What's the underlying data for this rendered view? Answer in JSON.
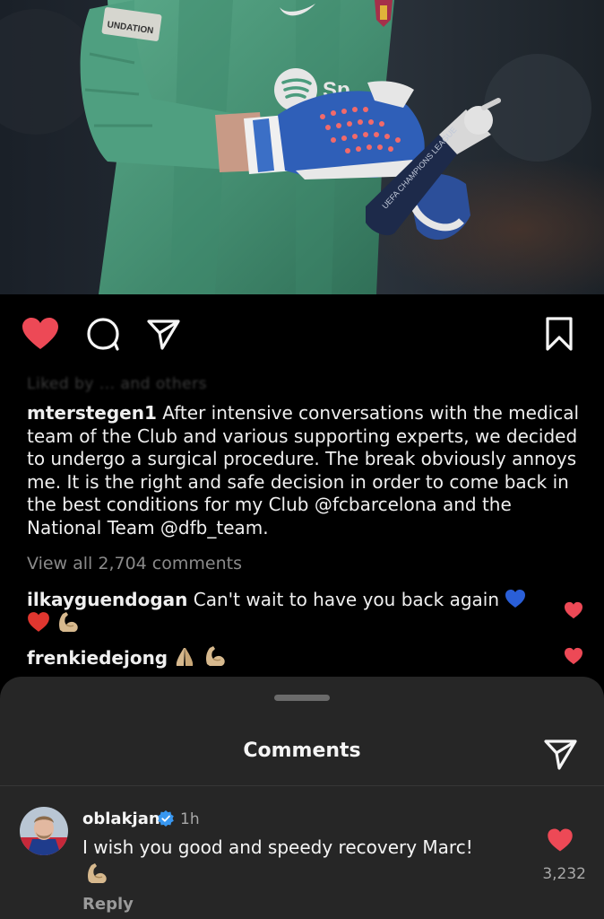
{
  "photo": {
    "collar_badge_text": "UNDATION",
    "sponsor_text": "Sp",
    "bottle_text": "UEFA CHAMPIONS LEAGUE"
  },
  "icons": {
    "like": "heart-filled-icon",
    "comment": "comment-bubble-icon",
    "share": "paper-plane-icon",
    "save": "bookmark-icon",
    "verified": "verified-badge-icon"
  },
  "post": {
    "liked_by_blurred": "Liked by ... and others",
    "caption_user": "mterstegen1",
    "caption_text": " After intensive conversations with the medical team of the Club and various supporting experts, we decided to undergo a surgical procedure. The break obviously annoys me. It is the right and safe decision in order to come back in the best conditions for my Club @fcbarcelona and the National Team @dfb_team.",
    "view_all_comments": "View all 2,704 comments",
    "preview_comments": [
      {
        "user": "ilkayguendogan",
        "text": " Can't wait to have you back again"
      },
      {
        "user": "frenkiedejong",
        "text": " "
      }
    ]
  },
  "comments_sheet": {
    "title": "Comments",
    "comment": {
      "user": "oblakjan",
      "time": "1h",
      "text": "I wish you good and speedy recovery Marc!",
      "like_count": "3,232",
      "reply_label": "Reply"
    }
  },
  "colors": {
    "like_red": "#ed4956",
    "background": "#000000",
    "sheet_background": "#262626",
    "muted_text": "#a8a8a8",
    "verified_blue": "#3897f0",
    "kit_green": "#4b9c7d"
  }
}
